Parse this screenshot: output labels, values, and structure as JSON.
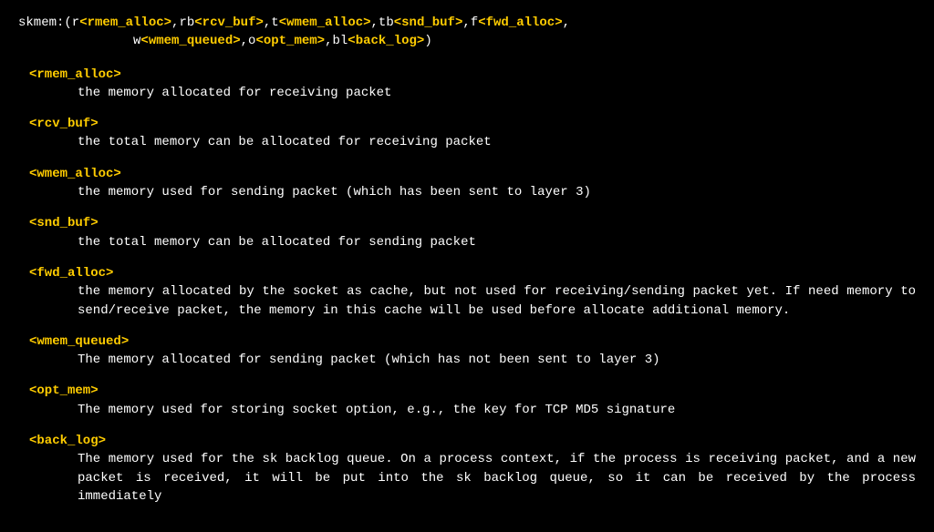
{
  "header": {
    "prefix": "skmem:(r",
    "p1": "<rmem_alloc>",
    "s2": ",rb",
    "p2": "<rcv_buf>",
    "s3": ",t",
    "p3": "<wmem_alloc>",
    "s4": ",tb",
    "p4": "<snd_buf>",
    "s5": ",f",
    "p5": "<fwd_alloc>",
    "s6": ",",
    "line2pad": "               w",
    "p6": "<wmem_queued>",
    "s7": ",o",
    "p7": "<opt_mem>",
    "s8": ",bl",
    "p8": "<back_log>",
    "s9": ")"
  },
  "entries": [
    {
      "term": "<rmem_alloc>",
      "def": "the memory allocated for receiving packet"
    },
    {
      "term": "<rcv_buf>",
      "def": "the total memory can be allocated for receiving packet"
    },
    {
      "term": "<wmem_alloc>",
      "def": "the memory used for sending packet (which has been sent to layer 3)"
    },
    {
      "term": "<snd_buf>",
      "def": "the total memory can be allocated for sending packet"
    },
    {
      "term": "<fwd_alloc>",
      "def": "the  memory  allocated  by  the socket as cache, but not used for receiving/sending packet yet. If need memory to send/receive packet, the memory in this cache will be used before allocate additional memory."
    },
    {
      "term": "<wmem_queued>",
      "def": "The memory allocated for sending packet (which has not been sent to layer 3)"
    },
    {
      "term": "<opt_mem>",
      "def": "The memory used for storing socket option, e.g., the key for TCP MD5 signature"
    },
    {
      "term": "<back_log>",
      "def": "The memory used for the sk backlog queue. On a process context, if the process is receiving packet, and a  new  packet  is  received,  it  will  be put into the sk backlog queue, so it can be received by the process immediately"
    }
  ]
}
